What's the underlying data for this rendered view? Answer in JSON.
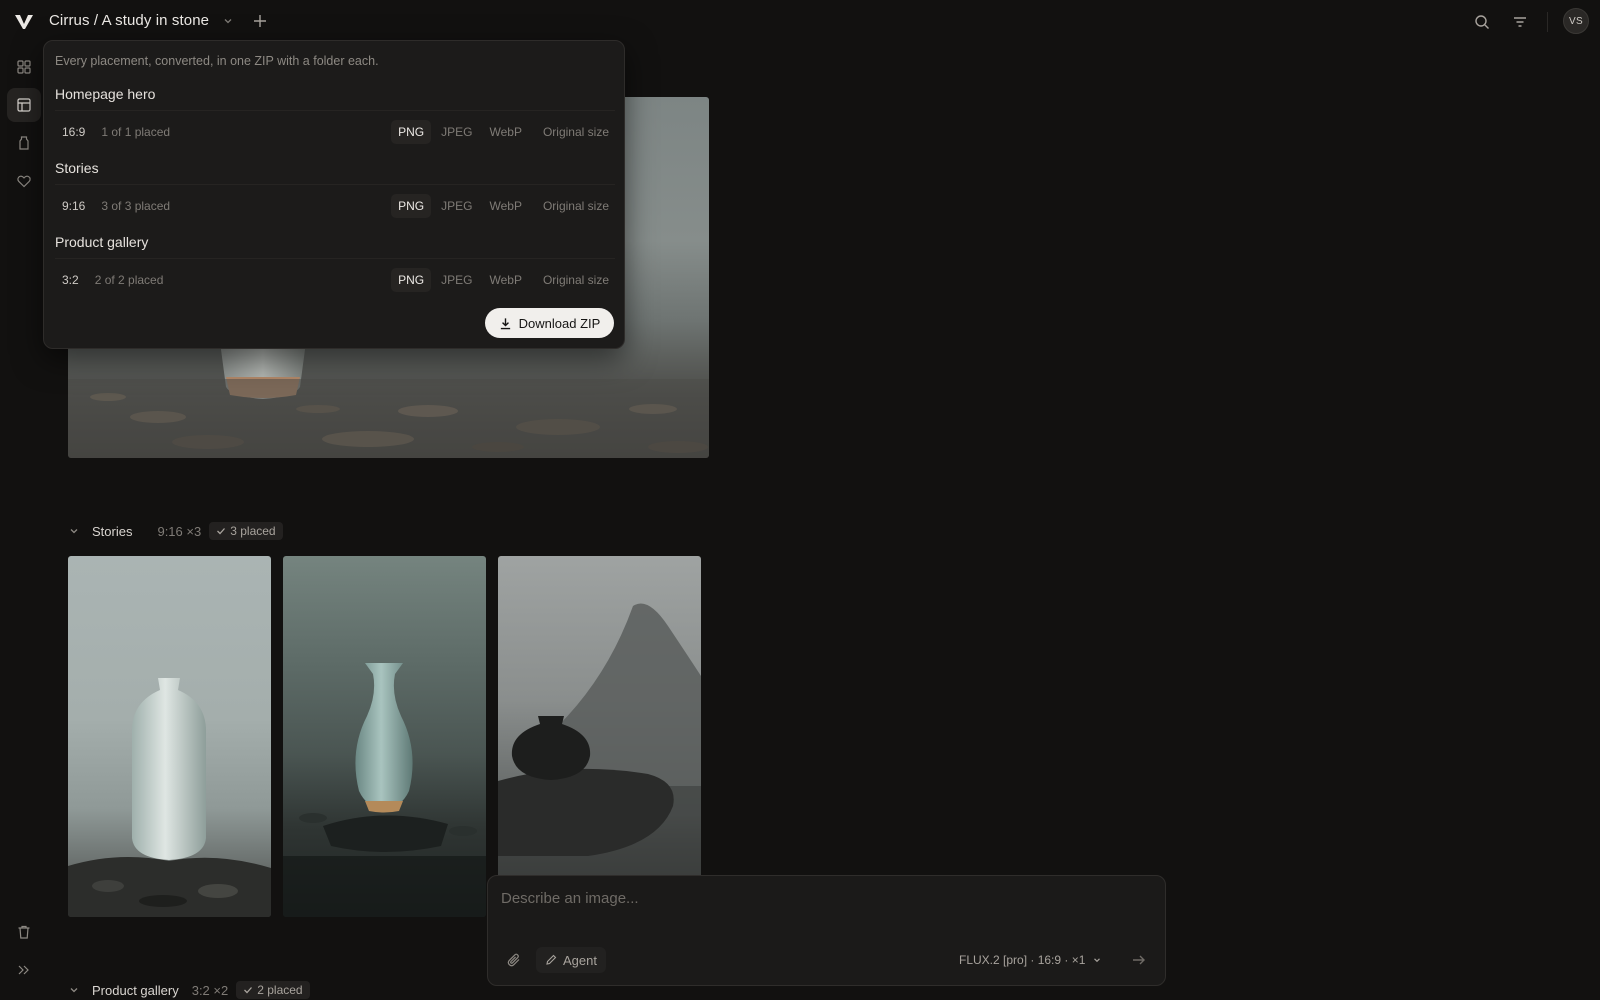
{
  "header": {
    "breadcrumb": "Cirrus / A study in stone",
    "avatar_initials": "VS"
  },
  "rail": {
    "items": [
      "grid-icon",
      "layout-icon",
      "jar-icon",
      "heart-icon"
    ],
    "bottom_items": [
      "trash-icon",
      "expand-icon"
    ]
  },
  "export_popover": {
    "description": "Every placement, converted, in one ZIP with a folder each.",
    "groups": [
      {
        "title": "Homepage hero",
        "ratio": "16:9",
        "placed": "1 of 1 placed",
        "formats": [
          "PNG",
          "JPEG",
          "WebP"
        ],
        "selected_format": "PNG",
        "size": "Original size"
      },
      {
        "title": "Stories",
        "ratio": "9:16",
        "placed": "3 of 3 placed",
        "formats": [
          "PNG",
          "JPEG",
          "WebP"
        ],
        "selected_format": "PNG",
        "size": "Original size"
      },
      {
        "title": "Product gallery",
        "ratio": "3:2",
        "placed": "2 of 2 placed",
        "formats": [
          "PNG",
          "JPEG",
          "WebP"
        ],
        "selected_format": "PNG",
        "size": "Original size"
      }
    ],
    "download_label": "Download ZIP"
  },
  "sections": {
    "stories": {
      "title": "Stories",
      "meta": "9:16 ×3",
      "badge": "3 placed"
    },
    "product_gallery": {
      "title": "Product gallery",
      "meta": "3:2 ×2",
      "badge": "2 placed"
    }
  },
  "composer": {
    "placeholder": "Describe an image...",
    "agent_label": "Agent",
    "model_label": "FLUX.2 [pro] · 16:9 · ×1"
  },
  "colors": {
    "background": "#121110",
    "popover": "#1c1b1a",
    "accent_button": "#f1efec"
  }
}
